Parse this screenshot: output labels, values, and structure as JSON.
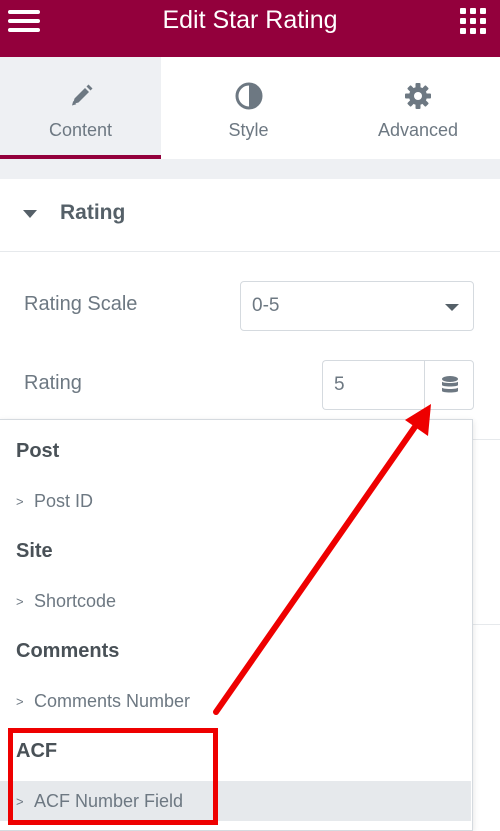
{
  "header": {
    "title": "Edit Star Rating",
    "menu_icon": "hamburger-icon",
    "widgets_icon": "grid-icon",
    "background": "#93003c"
  },
  "tabs": [
    {
      "label": "Content",
      "icon": "pencil-icon",
      "active": true
    },
    {
      "label": "Style",
      "icon": "half-circle-icon",
      "active": false
    },
    {
      "label": "Advanced",
      "icon": "gear-icon",
      "active": false
    }
  ],
  "section": {
    "title": "Rating",
    "caret_icon": "caret-down-icon"
  },
  "controls": {
    "rating_scale": {
      "label": "Rating Scale",
      "value": "0-5"
    },
    "rating": {
      "label": "Rating",
      "value": "5",
      "dynamic_icon": "database-icon"
    }
  },
  "dynamic_dropdown": {
    "groups": [
      {
        "title": "Post",
        "items": [
          "Post ID"
        ]
      },
      {
        "title": "Site",
        "items": [
          "Shortcode"
        ]
      },
      {
        "title": "Comments",
        "items": [
          "Comments Number"
        ]
      },
      {
        "title": "ACF",
        "items": [
          "ACF Number Field"
        ]
      }
    ],
    "item_prefix": ">"
  },
  "annotation": {
    "color": "#ee0000"
  }
}
